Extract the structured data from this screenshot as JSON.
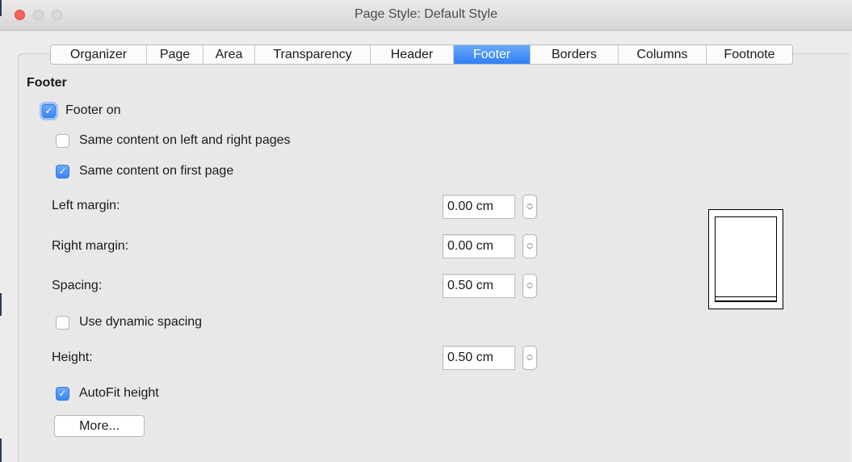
{
  "window": {
    "title": "Page Style: Default Style"
  },
  "tabs": [
    {
      "label": "Organizer"
    },
    {
      "label": "Page"
    },
    {
      "label": "Area"
    },
    {
      "label": "Transparency"
    },
    {
      "label": "Header"
    },
    {
      "label": "Footer",
      "active": true
    },
    {
      "label": "Borders"
    },
    {
      "label": "Columns"
    },
    {
      "label": "Footnote"
    }
  ],
  "footer": {
    "section_title": "Footer",
    "footer_on": {
      "label": "Footer on",
      "checked": true
    },
    "same_content_left_right": {
      "label": "Same content on left and right pages",
      "checked": false
    },
    "same_content_first_page": {
      "label": "Same content on first page",
      "checked": true
    },
    "left_margin": {
      "label": "Left margin:",
      "value": "0.00 cm"
    },
    "right_margin": {
      "label": "Right margin:",
      "value": "0.00 cm"
    },
    "spacing": {
      "label": "Spacing:",
      "value": "0.50 cm"
    },
    "use_dynamic_spacing": {
      "label": "Use dynamic spacing",
      "checked": false
    },
    "height": {
      "label": "Height:",
      "value": "0.50 cm"
    },
    "autofit_height": {
      "label": "AutoFit height",
      "checked": true
    },
    "more_button": "More..."
  },
  "colors": {
    "accent": "#3a86f6",
    "close": "#fc605c"
  }
}
